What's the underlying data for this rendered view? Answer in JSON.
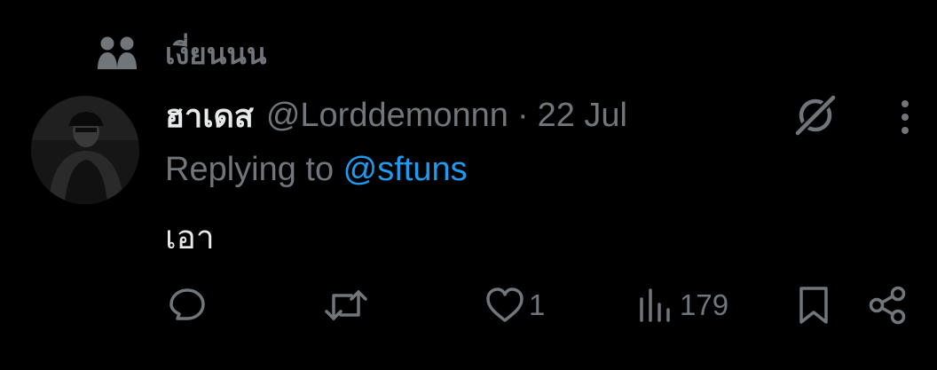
{
  "social_context": {
    "icon": "people-icon",
    "text": "เงี่ยนนน"
  },
  "tweet": {
    "avatar": "avatar",
    "display_name": "ฮาเดส",
    "handle": "@Lorddemonnn",
    "separator": "·",
    "timestamp": "22 Jul",
    "replying_prefix": "Replying to ",
    "replying_to": "@sftuns",
    "text": "เอา"
  },
  "actions": {
    "reply": {
      "icon": "reply-icon"
    },
    "retweet": {
      "icon": "retweet-icon"
    },
    "like": {
      "icon": "heart-icon",
      "count": "1"
    },
    "views": {
      "icon": "views-icon",
      "count": "179"
    },
    "bookmark": {
      "icon": "bookmark-icon"
    },
    "share": {
      "icon": "share-icon"
    }
  },
  "colors": {
    "background": "#000000",
    "primary_text": "#e7e9ea",
    "secondary_text": "#71767b",
    "link": "#1d9bf0"
  }
}
